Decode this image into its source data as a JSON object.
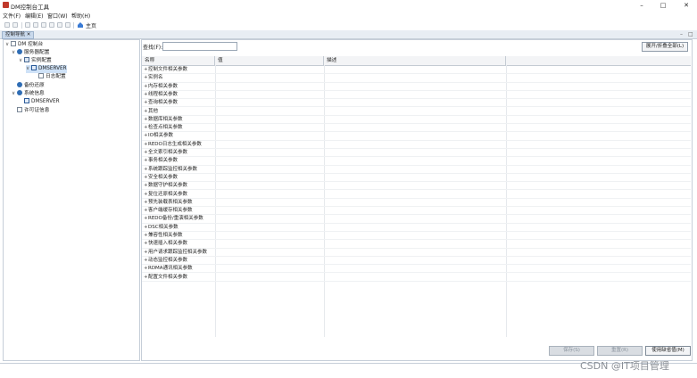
{
  "window": {
    "title": "DM控制台工具",
    "controls": {
      "minimize": "–",
      "maximize": "□",
      "close": "✕"
    }
  },
  "menu": [
    "文件(F)",
    "编辑(E)",
    "窗口(W)",
    "帮助(H)"
  ],
  "toolbar": {
    "home_label": "主页"
  },
  "panel_tab": {
    "label": "控制导航",
    "close": "✕"
  },
  "tree": [
    {
      "label": "DM 控制台",
      "toggle": "∨",
      "icon": "console-icon"
    },
    {
      "label": "服务器配置",
      "toggle": "∨",
      "icon": "gear-icon"
    },
    {
      "label": "实例配置",
      "toggle": "∨",
      "icon": "instance-config-icon"
    },
    {
      "label": "DMSERVER",
      "toggle": "∨",
      "icon": "server-icon"
    },
    {
      "label": "日志配置",
      "toggle": "",
      "icon": "log-config-icon"
    },
    {
      "label": "备份还原",
      "toggle": "",
      "icon": "backup-icon"
    },
    {
      "label": "系统信息",
      "toggle": "∨",
      "icon": "system-info-icon"
    },
    {
      "label": "DMSERVER",
      "toggle": "",
      "icon": "server-icon"
    },
    {
      "label": "许可证信息",
      "toggle": "",
      "icon": "license-icon"
    }
  ],
  "search": {
    "label": "查找(F):",
    "value": ""
  },
  "expand_button": "展开/折叠全部(L)",
  "table": {
    "columns": [
      "名称",
      "值",
      "描述"
    ],
    "rows": [
      "控制文件相关参数",
      "实例名",
      "内存相关参数",
      "线程相关参数",
      "查询相关参数",
      "其他",
      "数据库相关参数",
      "检查点相关参数",
      "IO相关参数",
      "REDO日志生成相关参数",
      "全文索引相关参数",
      "事务相关参数",
      "系统跟踪监控相关参数",
      "安全相关参数",
      "数据守护相关参数",
      "复位还原相关参数",
      "预先装载表相关参数",
      "客户端缓存相关参数",
      "REDO备份/重演相关参数",
      "DSC相关参数",
      "兼容性相关参数",
      "快速插入相关参数",
      "用户请求跟踪监控相关参数",
      "动态监控相关参数",
      "RDMA通讯相关参数",
      "配置文件相关参数"
    ],
    "row_marker": "+"
  },
  "buttons": {
    "save": "保存(S)",
    "reset": "重置(R)",
    "default": "使用缺省值(M)"
  },
  "watermark": "CSDN @IT项目管理"
}
